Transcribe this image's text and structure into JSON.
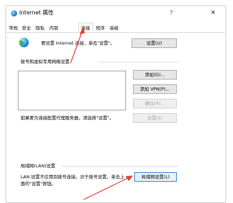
{
  "window": {
    "title": "Internet 属性",
    "help_glyph": "?",
    "close_glyph": "✕"
  },
  "tabs": [
    {
      "label": "常规",
      "selected": false
    },
    {
      "label": "安全",
      "selected": false
    },
    {
      "label": "隐私",
      "selected": false
    },
    {
      "label": "内容",
      "selected": false
    },
    {
      "label": "连接",
      "selected": true
    },
    {
      "label": "程序",
      "selected": false
    },
    {
      "label": "高级",
      "selected": false
    }
  ],
  "setup": {
    "text": "要设置 Internet 连接，单击\"设置\"。",
    "button": "设置(U)"
  },
  "dialup": {
    "group_title": "拨号和虚拟专用网络设置",
    "add_button": "添加(D)...",
    "add_vpn_button": "添加 VPN(P)...",
    "remove_button": "删除(R)...",
    "proxy_text": "如果要为连接配置代理服务器，请选择\"设置\"。",
    "settings_button": "设置(S)"
  },
  "lan": {
    "group_title": "局域网(LAN)设置",
    "text_line1": "LAN 设置不应用到拨号连接。对于拨号设置，单击上",
    "text_line2": "面的\"设置\"按钮。",
    "button": "局域网设置(L)"
  },
  "colors": {
    "annotation_arrow": "#e03c31",
    "focus_border": "#3b7fd0"
  }
}
